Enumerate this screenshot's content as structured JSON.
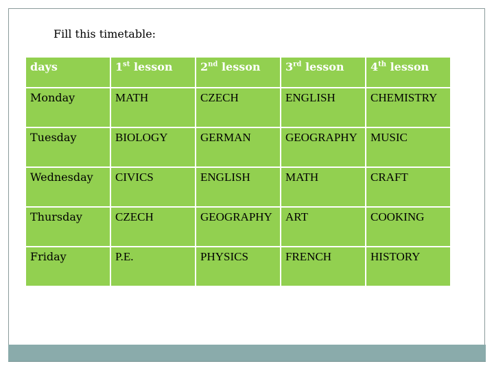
{
  "title": "Fill this timetable:",
  "table": {
    "header": [
      {
        "num": "days",
        "sup": "",
        "rest": ""
      },
      {
        "num": "1",
        "sup": "st",
        "rest": " lesson"
      },
      {
        "num": "2",
        "sup": "nd",
        "rest": " lesson"
      },
      {
        "num": "3",
        "sup": "rd",
        "rest": " lesson"
      },
      {
        "num": "4",
        "sup": "th",
        "rest": " lesson"
      }
    ],
    "rows": [
      [
        "Monday",
        "MATH",
        "CZECH",
        "ENGLISH",
        "CHEMISTRY"
      ],
      [
        "Tuesday",
        "BIOLOGY",
        "GERMAN",
        "GEOGRAPHY",
        "MUSIC"
      ],
      [
        "Wednesday",
        "CIVICS",
        "ENGLISH",
        "MATH",
        "CRAFT"
      ],
      [
        "Thursday",
        "CZECH",
        "GEOGRAPHY",
        "ART",
        "COOKING"
      ],
      [
        "Friday",
        "P.E.",
        "PHYSICS",
        "FRENCH",
        "HISTORY"
      ]
    ]
  },
  "colors": {
    "cell_fill": "#92d050",
    "header_text": "#ffffff",
    "footer_bar": "#8aabab"
  }
}
